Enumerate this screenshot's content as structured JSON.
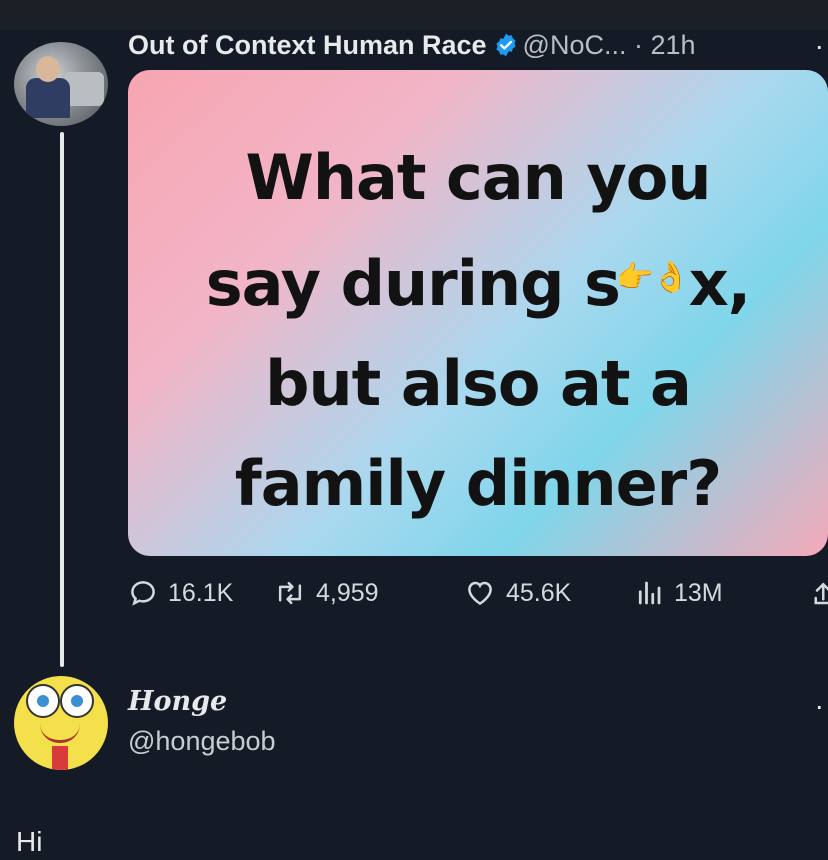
{
  "post": {
    "author_name": "Out of Context Human Race",
    "handle_time": "@NoC... · 21h",
    "more": "·",
    "image_text": [
      "What can you",
      "say during s",
      "x,",
      "but also at a",
      "family dinner?"
    ],
    "image_emoji": "👉👌",
    "stats": {
      "replies": "16.1K",
      "reposts": "4,959",
      "likes": "45.6K",
      "views": "13M"
    }
  },
  "reply": {
    "author_name": "Honge",
    "handle": "@hongebob",
    "more": "·",
    "text": "Hi"
  },
  "colors": {
    "background": "#141a26",
    "verified": "#1d9bf0"
  }
}
